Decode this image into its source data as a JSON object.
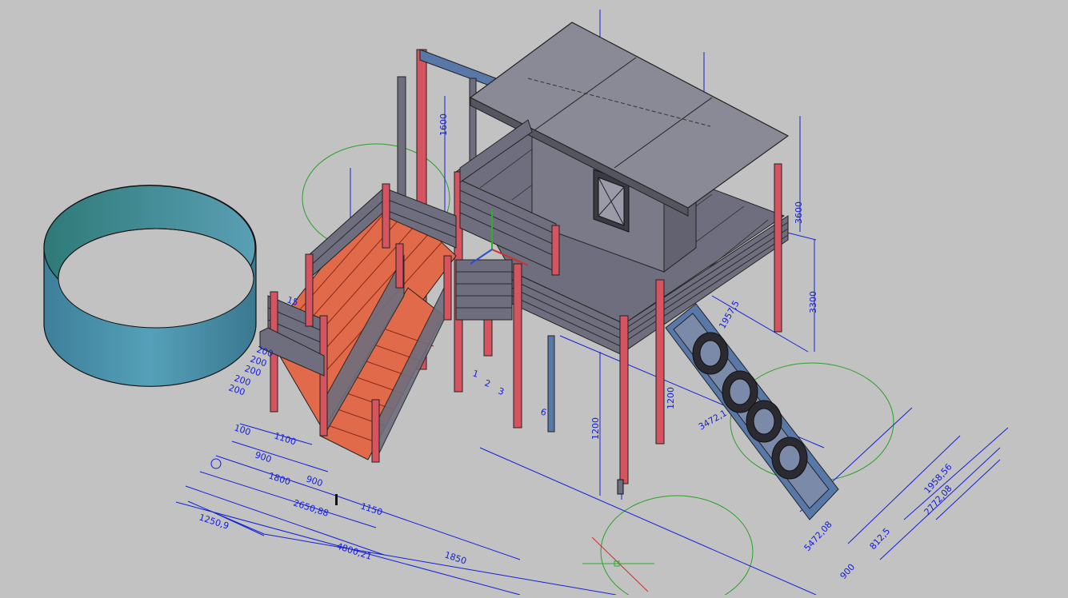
{
  "canvas": {
    "background": "#c2c2c2"
  },
  "colors": {
    "dimension": "#1420d8",
    "wood_red": "#d5545f",
    "wood_grey": "#6e6e7e",
    "stair_orange": "#e06a4a",
    "roof": "#8a8a96",
    "pool": "#4a8fa0",
    "circle": "#2aa02a",
    "slide": "#5878a8"
  },
  "dimensions": {
    "d1": "1250,9",
    "d2": "4800,21",
    "d3": "2650,88",
    "d4": "1800",
    "d5": "900",
    "d6": "900",
    "d7": "1150",
    "d8": "1850",
    "d9": "1100",
    "d10": "100",
    "d11": "5472,08",
    "d12": "812,5",
    "d13": "900",
    "d14": "1958,56",
    "d15": "2772,08",
    "d16": "200",
    "d17": "200",
    "d18": "200",
    "d19": "200",
    "d20": "200",
    "d21": "15",
    "d22": "1",
    "d23": "2",
    "d24": "3",
    "d25": "6",
    "d26": "3300",
    "d27": "1957,5",
    "d28": "1200",
    "d29": "3472,1",
    "d30": "1200",
    "d31": "1600",
    "d32": "3600"
  },
  "icons": [
    "ucs-icon",
    "crosshair-cursor"
  ]
}
